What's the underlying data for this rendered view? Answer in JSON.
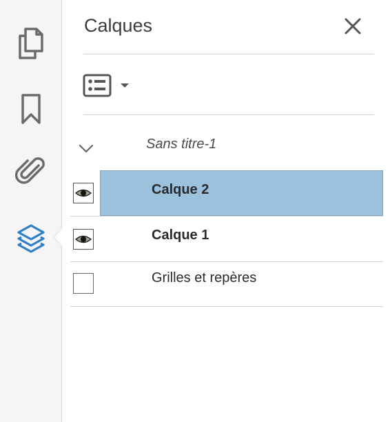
{
  "panel": {
    "title": "Calques"
  },
  "rail": {
    "items": [
      {
        "icon": "pages-icon"
      },
      {
        "icon": "bookmark-icon"
      },
      {
        "icon": "attachment-icon"
      },
      {
        "icon": "layers-icon",
        "active": true
      }
    ]
  },
  "document": {
    "name": "Sans titre-1",
    "expanded": true
  },
  "layers": [
    {
      "name": "Calque 2",
      "visible": true,
      "selected": true,
      "bold": true
    },
    {
      "name": "Calque 1",
      "visible": true,
      "selected": false,
      "bold": true
    },
    {
      "name": "Grilles et repères",
      "visible": false,
      "selected": false,
      "bold": false
    }
  ],
  "colors": {
    "accent": "#2d7fcb",
    "selection": "#9bc1dd",
    "icon_gray": "#6b6b6b"
  }
}
